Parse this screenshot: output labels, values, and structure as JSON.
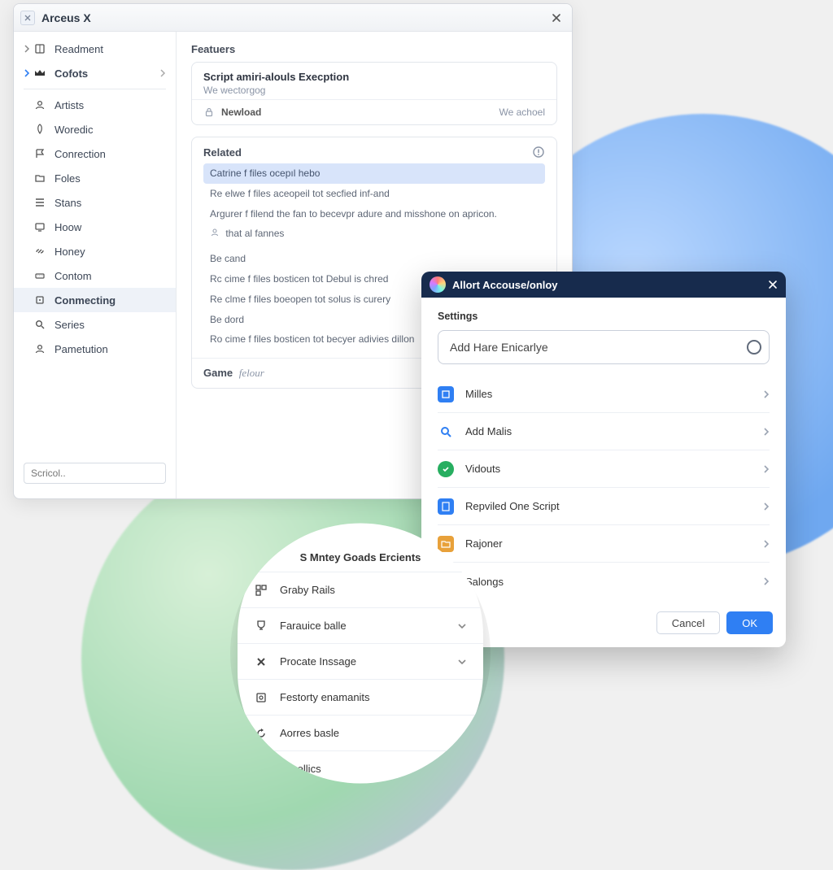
{
  "app": {
    "title": "Arceus X"
  },
  "sidebar": {
    "search_placeholder": "Scricol..",
    "items": [
      {
        "label": "Readment"
      },
      {
        "label": "Cofots"
      },
      {
        "label": "Artists"
      },
      {
        "label": "Woredic"
      },
      {
        "label": "Conrection"
      },
      {
        "label": "Foles"
      },
      {
        "label": "Stans"
      },
      {
        "label": "Hoow"
      },
      {
        "label": "Honey"
      },
      {
        "label": "Contom"
      },
      {
        "label": "Conmecting"
      },
      {
        "label": "Series"
      },
      {
        "label": "Pametution"
      }
    ]
  },
  "features": {
    "section_title": "Featuers",
    "card": {
      "title": "Script amiri-alouls Execption",
      "subtitle": "We wectorgog",
      "footer_left": "Newload",
      "footer_right": "We achoel"
    },
    "related_title": "Related",
    "log": [
      "Catrine f files ocepıl hebo",
      "Re elwe f files aceopeil tot secfied inf-and",
      "Argurer f filend the fan to becevpr adure and misshone on apricon.",
      "that al fannes",
      "Be cand",
      "Rc cime f files bosticen tot Debul is chred",
      "Re clme f files boeopen tot solus is curery",
      "Be dord",
      "Ro cime f files bosticen tot becyer adivies dillon"
    ],
    "game_label": "Game",
    "game_value": "felour"
  },
  "modal": {
    "title": "Allort Accouse/onloy",
    "section": "Settings",
    "search_text": "Add Hare Enicarlye",
    "rows": [
      {
        "label": "Milles",
        "color": "#2f7ff3"
      },
      {
        "label": "Add Malis",
        "color": "#2f7ff3"
      },
      {
        "label": "Vidouts",
        "color": "#27ae60"
      },
      {
        "label": "Repviled One Script",
        "color": "#2f7ff3"
      },
      {
        "label": "Rajoner",
        "color": "#e8a13a"
      },
      {
        "label": "Salongs",
        "color": "#9b59b6"
      }
    ],
    "cancel": "Cancel",
    "ok": "OK"
  },
  "menu": {
    "title": "S Mntey Goads Ercients",
    "items": [
      {
        "label": "Graby Rails"
      },
      {
        "label": "Farauice balle"
      },
      {
        "label": "Procate Inssage"
      },
      {
        "label": "Festorty enamanits"
      },
      {
        "label": "Aorres basle"
      },
      {
        "label": "Facellics"
      }
    ]
  }
}
